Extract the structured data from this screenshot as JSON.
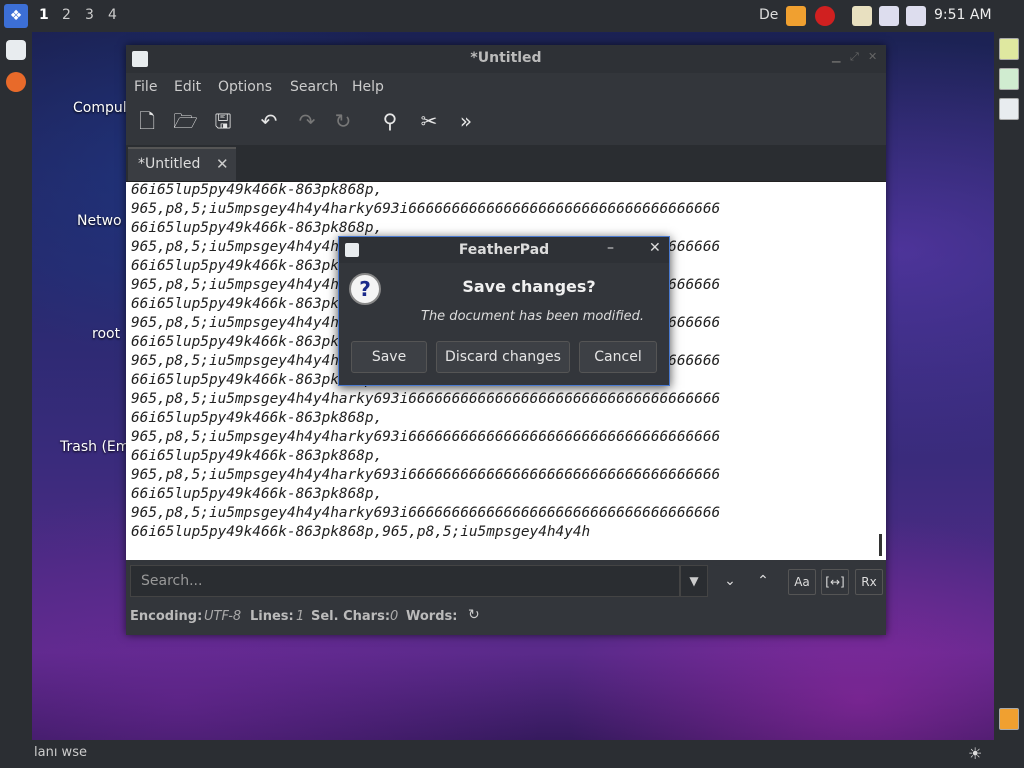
{
  "top_panel": {
    "workspaces": [
      "1",
      "2",
      "3",
      "4"
    ],
    "tray_text": "De",
    "clock": "9:51 AM"
  },
  "desktop_icons": [
    "Compul",
    "Netwo",
    "root",
    "Trash (Em"
  ],
  "bottom_bar": {
    "text": "lanı wse"
  },
  "editor": {
    "title": "*Untitled",
    "menu": [
      "File",
      "Edit",
      "Options",
      "Search",
      "Help"
    ],
    "tab_label": "*Untitled",
    "lines": [
      "66i65lup5py49k466k-863pk868p,",
      "965,p8,5;iu5mpsgey4h4y4harky693i666666666666666666666666666666666666",
      "66i65lup5py49k466k-863pk868p,",
      "965,p8,5;iu5mpsgey4h4y4harky693i666666666666666666666666666666666666",
      "66i65lup5py49k466k-863pk868p,",
      "965,p8,5;iu5mpsgey4h4y4harky693i666666666666666666666666666666666666",
      "66i65lup5py49k466k-863pk868p,",
      "965,p8,5;iu5mpsgey4h4y4harky693i666666666666666666666666666666666666",
      "66i65lup5py49k466k-863pk868p,",
      "965,p8,5;iu5mpsgey4h4y4harky693i666666666666666666666666666666666666",
      "66i65lup5py49k466k-863pk868p,",
      "965,p8,5;iu5mpsgey4h4y4harky693i666666666666666666666666666666666666",
      "66i65lup5py49k466k-863pk868p,",
      "965,p8,5;iu5mpsgey4h4y4harky693i666666666666666666666666666666666666",
      "66i65lup5py49k466k-863pk868p,",
      "965,p8,5;iu5mpsgey4h4y4harky693i666666666666666666666666666666666666",
      "66i65lup5py49k466k-863pk868p,",
      "965,p8,5;iu5mpsgey4h4y4harky693i666666666666666666666666666666666666",
      "66i65lup5py49k466k-863pk868p,965,p8,5;iu5mpsgey4h4y4h"
    ],
    "search_placeholder": "Search...",
    "status": {
      "encoding_label": "Encoding:",
      "encoding_value": "UTF-8",
      "lines_label": "Lines:",
      "lines_value": "1",
      "sel_label": "Sel. Chars:",
      "sel_value": "0",
      "words_label": "Words:"
    }
  },
  "dialog": {
    "title": "FeatherPad",
    "heading": "Save changes?",
    "message": "The document has been modified.",
    "save_label": "Save",
    "discard_label": "Discard changes",
    "cancel_label": "Cancel"
  },
  "colors": {
    "accent": "#4a7ad0",
    "panel": "#2b2e33",
    "window": "#33363b"
  }
}
